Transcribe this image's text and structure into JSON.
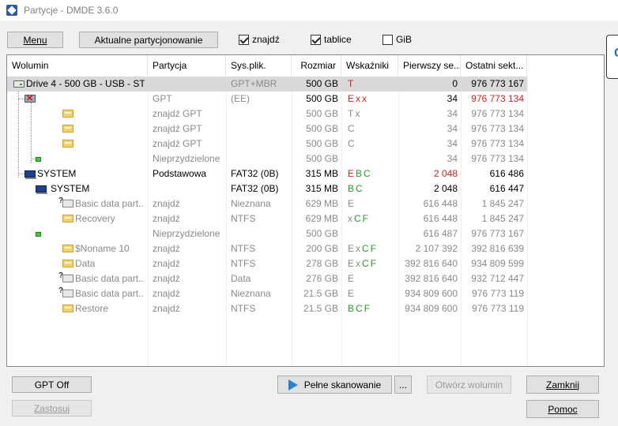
{
  "window": {
    "title": "Partycje - DMDE 3.6.0"
  },
  "toolbar": {
    "menu": "Menu",
    "current_partitioning": "Aktualne partycjonowanie",
    "find": "znajdź",
    "find_checked": true,
    "tables": "tablice",
    "tables_checked": true,
    "gib": "GiB",
    "gib_checked": false
  },
  "side_panel": {
    "glyph": "C"
  },
  "columns": [
    "Wolumin",
    "Partycja",
    "Sys.plik.",
    "Rozmiar",
    "Wskaźniki",
    "Pierwszy se...",
    "Ostatni sekt..."
  ],
  "rows": [
    {
      "name": "Drive 4 - 500 GB - USB - ST...",
      "icon": "drive-icon",
      "partition": "",
      "fs": "GPT+MBR",
      "size": "500 GB",
      "flags": "T",
      "first": "0",
      "last": "976 773 167",
      "style": "selected"
    },
    {
      "name": "",
      "icon": "damaged-partition-icon",
      "partition": "GPT",
      "fs": "(EE)",
      "size": "500 GB",
      "flags": "Exx",
      "first": "34",
      "last": "976 773 134",
      "style": "gpt"
    },
    {
      "name": "",
      "icon": "folder-icon",
      "partition": "znajdź GPT",
      "fs": "",
      "size": "500 GB",
      "flags": "Tx",
      "first": "34",
      "last": "976 773 134",
      "style": "gray"
    },
    {
      "name": "",
      "icon": "folder-icon",
      "partition": "znajdź GPT",
      "fs": "",
      "size": "500 GB",
      "flags": "C",
      "first": "34",
      "last": "976 773 134",
      "style": "gray"
    },
    {
      "name": "",
      "icon": "folder-icon",
      "partition": "znajdź GPT",
      "fs": "",
      "size": "500 GB",
      "flags": "C",
      "first": "34",
      "last": "976 773 134",
      "style": "gray"
    },
    {
      "name": "",
      "icon": "free-space-icon",
      "partition": "Nieprzydzielone",
      "fs": "",
      "size": "500 GB",
      "flags": "",
      "first": "34",
      "last": "976 773 134",
      "style": "gray"
    },
    {
      "name": "SYSTEM",
      "icon": "windows-partition-icon",
      "partition": "Podstawowa",
      "fs": "FAT32 (0B)",
      "size": "315 MB",
      "flags": "EBC",
      "first": "2 048",
      "last": "616 486",
      "style": "system"
    },
    {
      "name": "SYSTEM",
      "icon": "windows-partition-icon",
      "partition": "",
      "fs": "FAT32 (0B)",
      "size": "315 MB",
      "flags": "BC",
      "first": "2 048",
      "last": "616 447",
      "style": "black"
    },
    {
      "name": "Basic data part...",
      "icon": "unknown-volume-icon",
      "partition": "znajdź",
      "fs": "Nieznana",
      "size": "629 MB",
      "flags": "E",
      "first": "616 448",
      "last": "1 845 247",
      "style": "gray"
    },
    {
      "name": "Recovery",
      "icon": "folder-icon",
      "partition": "znajdź",
      "fs": "NTFS",
      "size": "629 MB",
      "flags": "xCF",
      "first": "616 448",
      "last": "1 845 247",
      "style": "gray"
    },
    {
      "name": "",
      "icon": "free-space-icon",
      "partition": "Nieprzydzielone",
      "fs": "",
      "size": "500 GB",
      "flags": "",
      "first": "616 487",
      "last": "976 773 167",
      "style": "gray"
    },
    {
      "name": "$Noname 10",
      "icon": "folder-icon",
      "partition": "znajdź",
      "fs": "NTFS",
      "size": "200 GB",
      "flags": "ExCF",
      "first": "2 107 392",
      "last": "392 816 639",
      "style": "gray"
    },
    {
      "name": "Data",
      "icon": "folder-icon",
      "partition": "znajdź",
      "fs": "NTFS",
      "size": "278 GB",
      "flags": "ExCF",
      "first": "392 816 640",
      "last": "934 809 599",
      "style": "gray"
    },
    {
      "name": "Basic data part...",
      "icon": "unknown-volume-icon",
      "partition": "znajdź",
      "fs": "Data",
      "size": "276 GB",
      "flags": "E",
      "first": "392 816 640",
      "last": "932 712 447",
      "style": "gray"
    },
    {
      "name": "Basic data part...",
      "icon": "unknown-volume-icon",
      "partition": "znajdź",
      "fs": "Nieznana",
      "size": "21.5 GB",
      "flags": "E",
      "first": "934 809 600",
      "last": "976 773 119",
      "style": "gray"
    },
    {
      "name": "Restore",
      "icon": "folder-icon",
      "partition": "znajdź",
      "fs": "NTFS",
      "size": "21.5 GB",
      "flags": "BCF",
      "first": "934 809 600",
      "last": "976 773 119",
      "style": "gray"
    }
  ],
  "buttons": {
    "gpt_off": "GPT Off",
    "apply": "Zastosuj",
    "full_scan": "Pełne skanowanie",
    "more": "...",
    "open_volume": "Otwórz wolumin",
    "close": "Zamknij",
    "help": "Pomoc"
  },
  "colors": {
    "flag_red": "#e02020",
    "flag_green": "#2a9a2a",
    "text_gray": "#8a8a8a",
    "selection": "#d9d9d9"
  }
}
